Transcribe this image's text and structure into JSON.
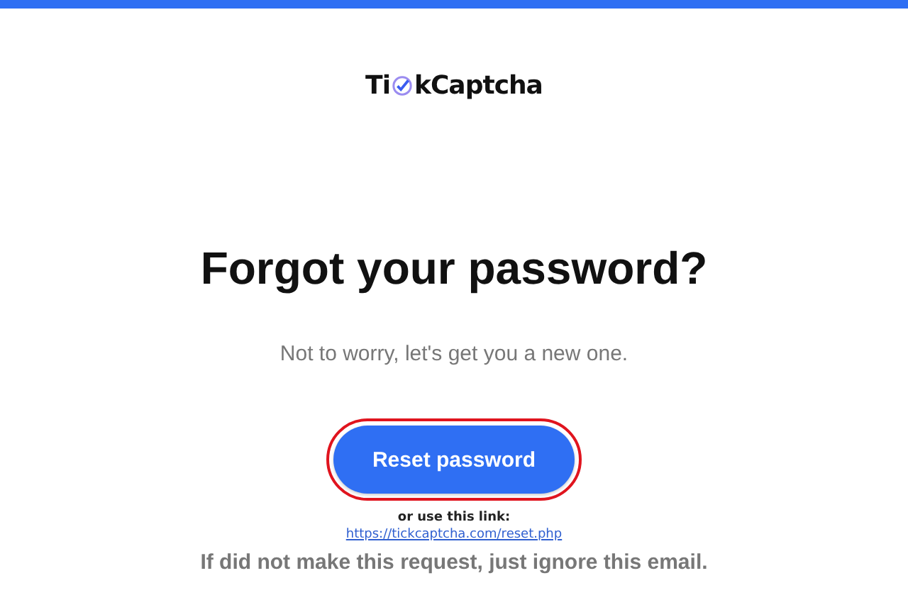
{
  "logo": {
    "before_icon": "Ti",
    "after_icon": "kCaptcha"
  },
  "heading": "Forgot your password?",
  "subtitle": "Not to worry, let's get you a new one.",
  "reset_button": {
    "label": "Reset password",
    "highlighted": true
  },
  "alt_link_label": "or use this link:",
  "alt_link": "https://tickcaptcha.com/reset.php",
  "footer_note": "If did not make this request, just ignore this email."
}
